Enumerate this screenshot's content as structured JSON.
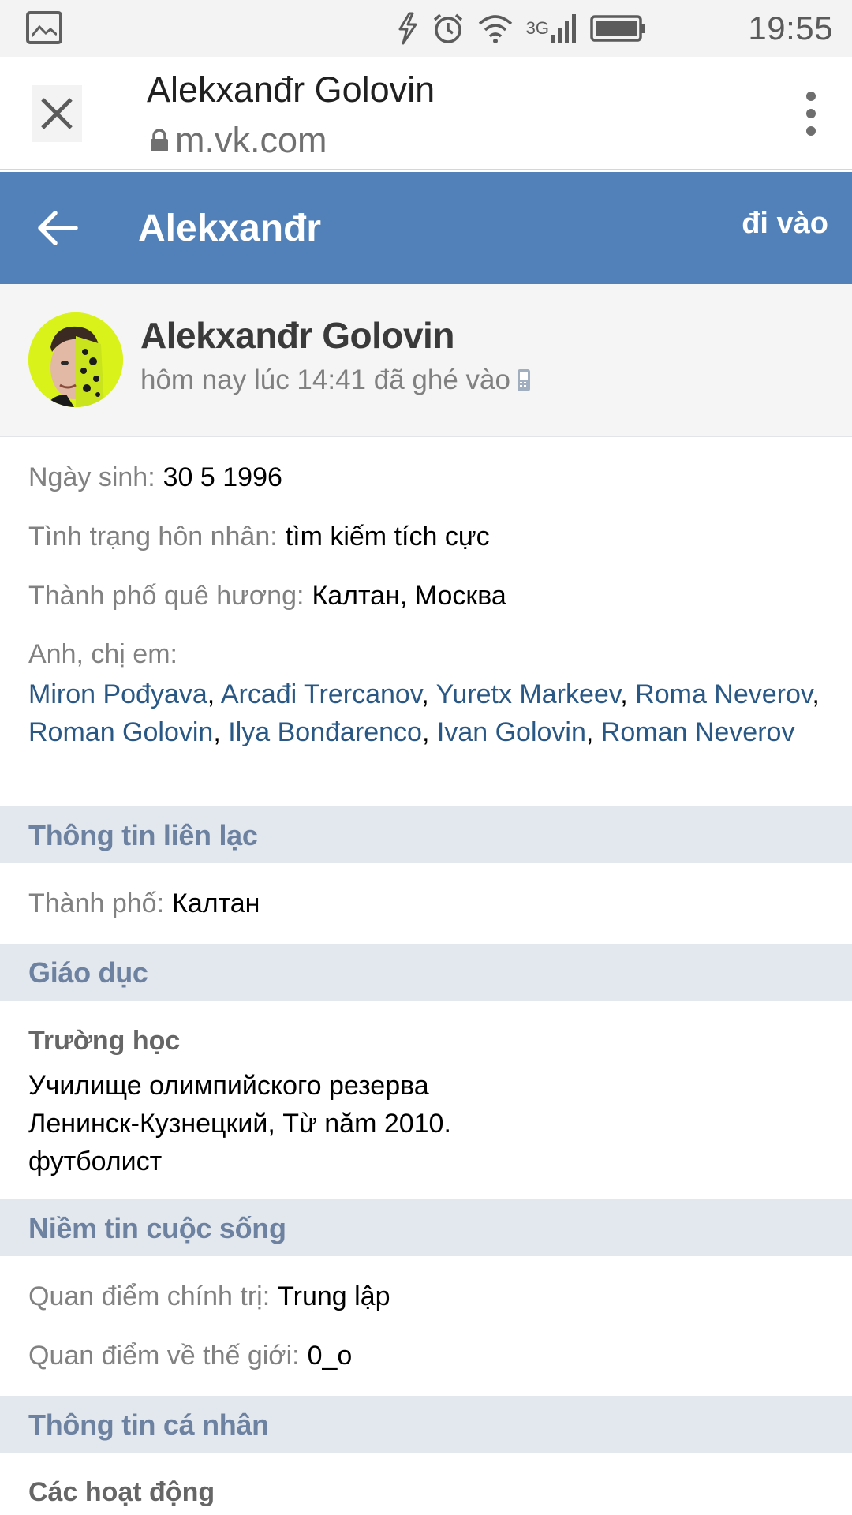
{
  "status_bar": {
    "network": "3G",
    "time": "19:55"
  },
  "browser": {
    "page_title": "Alekxanđr Golovin",
    "url": "m.vk.com"
  },
  "app_header": {
    "title": "Alekxanđr",
    "login_label": "đi vào",
    "accent_color": "#5181b8"
  },
  "profile": {
    "name": "Alekxanđr Golovin",
    "last_seen": "hôm nay lúc 14:41 đã ghé vào"
  },
  "info": {
    "birthday": {
      "label": "Ngày sinh:",
      "value": "30 5 1996"
    },
    "relationship": {
      "label": "Tình trạng hôn nhân:",
      "value": "tìm kiếm tích cực"
    },
    "hometown": {
      "label": "Thành phố quê hương:",
      "value": "Калтан, Москва"
    },
    "siblings_label": "Anh, chị em:",
    "siblings": [
      "Miron Pođyava",
      "Arcađi Trercanov",
      "Yuretx Markeev",
      "Roma Neverov",
      "Roman Golovin",
      "Ilya Bonđarenco",
      "Ivan Golovin",
      "Roman Neverov"
    ],
    "separator": ", "
  },
  "sections": {
    "contacts": {
      "title": "Thông tin liên lạc",
      "city_label": "Thành phố:",
      "city_value": "Калтан"
    },
    "education": {
      "title": "Giáo dục",
      "school_heading": "Trường học",
      "school_line1": "Училище олимпийского резерва",
      "school_line2": "Ленинск-Кузнецкий, Từ năm 2010.",
      "school_line3": "футболист"
    },
    "beliefs": {
      "title": "Niềm tin cuộc sống",
      "political_label": "Quan điểm chính trị:",
      "political_value": "Trung lập",
      "worldview_label": "Quan điểm về thế giới:",
      "worldview_value": "0_o"
    },
    "personal": {
      "title": "Thông tin cá nhân",
      "activities_heading": "Các hoạt động"
    }
  }
}
